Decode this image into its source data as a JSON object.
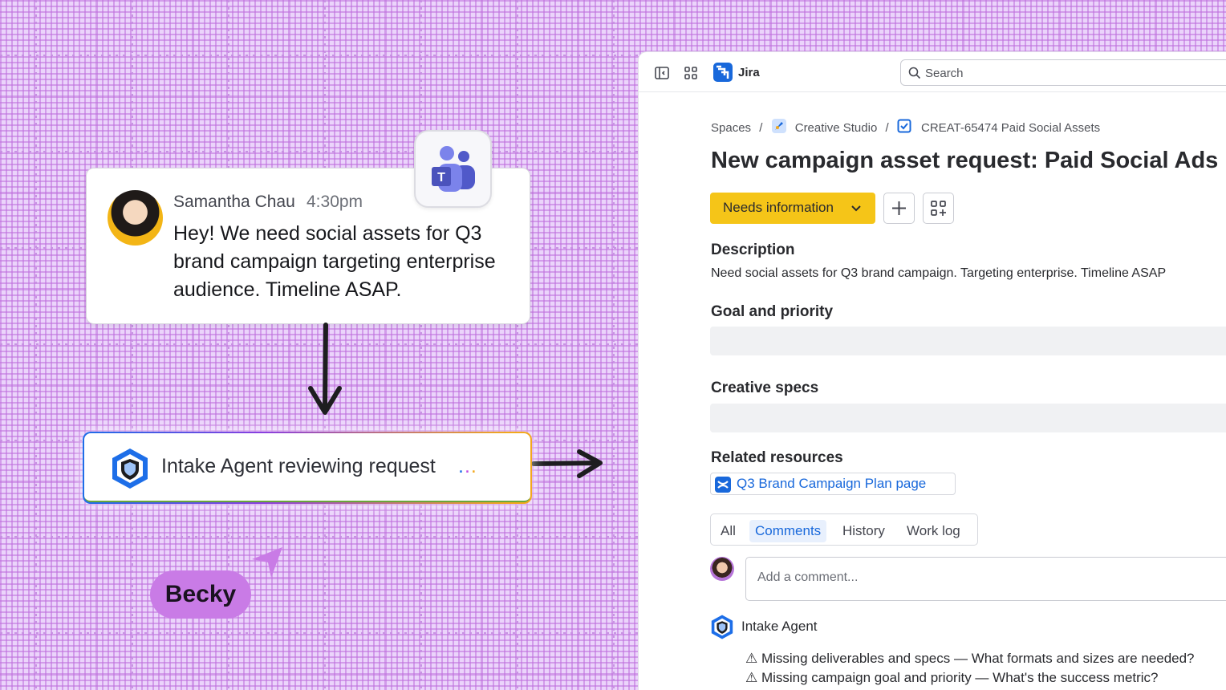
{
  "message": {
    "sender": "Samantha Chau",
    "time": "4:30pm",
    "text": "Hey! We need social assets for Q3 brand campaign targeting enterprise audience. Timeline ASAP."
  },
  "agent_status": {
    "label": "Intake Agent reviewing request",
    "dots_colors": [
      "#1d6ee8",
      "#c04ae0",
      "#f2a81d"
    ]
  },
  "cursor": {
    "name": "Becky",
    "color": "#c97be6"
  },
  "jira": {
    "app_name": "Jira",
    "search_placeholder": "Search",
    "breadcrumbs": {
      "spaces": "Spaces",
      "space": "Creative Studio",
      "issue": "CREAT-65474 Paid Social Assets"
    },
    "title": "New campaign asset request: Paid Social Ads",
    "status": "Needs information",
    "status_color": "#f5c518",
    "sections": {
      "description": "Description",
      "description_text": "Need social assets for Q3 brand campaign. Targeting enterprise. Timeline ASAP",
      "goal": "Goal and priority",
      "specs": "Creative specs",
      "related": "Related resources"
    },
    "related_link": "Q3 Brand Campaign Plan page",
    "activity_tabs": [
      "All",
      "Comments",
      "History",
      "Work log"
    ],
    "active_tab": "Comments",
    "comment_placeholder": "Add a comment...",
    "agent_comment": {
      "author": "Intake Agent",
      "lines": [
        "⚠ Missing deliverables and specs — What formats and sizes are needed?",
        "⚠ Missing campaign goal and priority — What's the success metric?"
      ]
    },
    "accent": "#1868db"
  }
}
